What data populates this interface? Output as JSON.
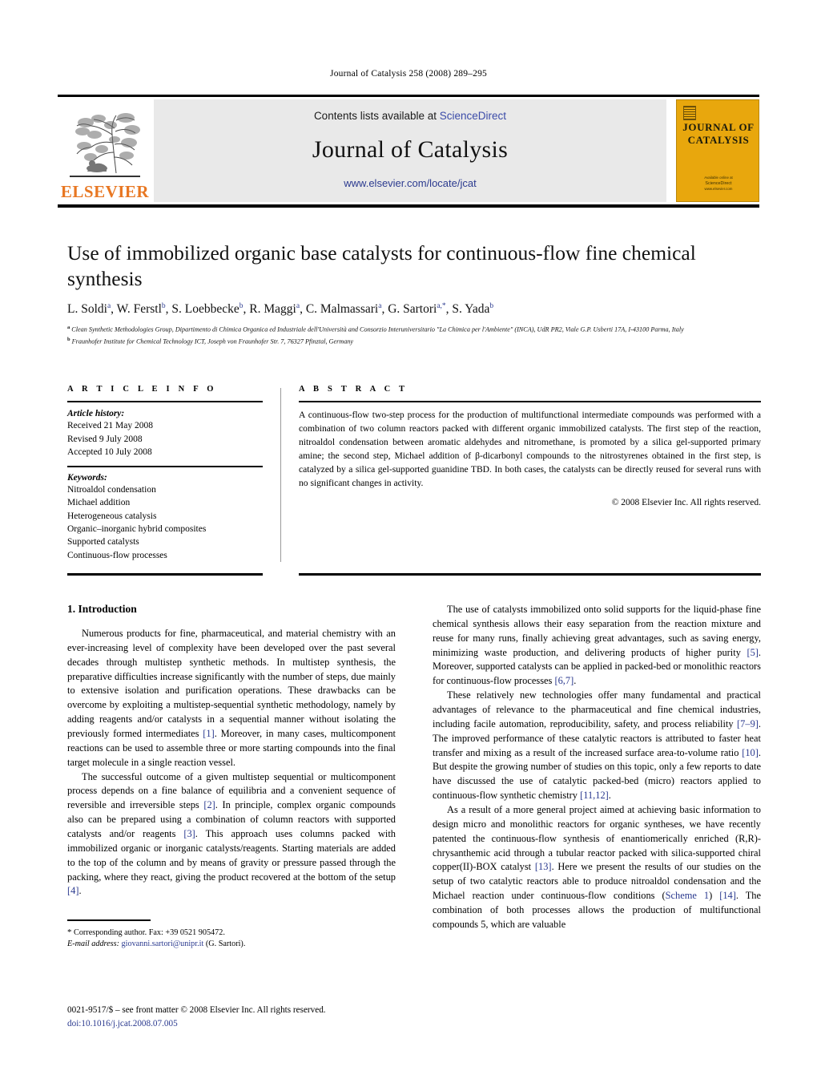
{
  "running_head": "Journal of Catalysis 258 (2008) 289–295",
  "masthead": {
    "publisher_logo_text": "ELSEVIER",
    "contents_prefix": "Contents lists available at ",
    "contents_link": "ScienceDirect",
    "journal_name": "Journal of Catalysis",
    "journal_url": "www.elsevier.com/locate/jcat",
    "cover_title_line1": "JOURNAL OF",
    "cover_title_line2": "CATALYSIS",
    "cover_foot_line1": "Available online at",
    "cover_foot_line2": "ScienceDirect",
    "cover_foot_line3": "www.elsevier.com"
  },
  "article": {
    "title": "Use of immobilized organic base catalysts for continuous-flow fine chemical synthesis",
    "authors": [
      {
        "name": "L. Soldi",
        "sup": "a"
      },
      {
        "name": "W. Ferstl",
        "sup": "b"
      },
      {
        "name": "S. Loebbecke",
        "sup": "b"
      },
      {
        "name": "R. Maggi",
        "sup": "a"
      },
      {
        "name": "C. Malmassari",
        "sup": "a"
      },
      {
        "name": "G. Sartori",
        "sup": "a,*"
      },
      {
        "name": "S. Yada",
        "sup": "b"
      }
    ],
    "affiliations": [
      {
        "marker": "a",
        "text": "Clean Synthetic Methodologies Group, Dipartimento di Chimica Organica ed Industriale dell'Università and Consorzio Interuniversitario \"La Chimica per l'Ambiente\" (INCA), UdR PR2, Viale G.P. Usberti 17A, I-43100 Parma, Italy"
      },
      {
        "marker": "b",
        "text": "Fraunhofer Institute for Chemical Technology ICT, Joseph von Fraunhofer Str. 7, 76327 Pfinztal, Germany"
      }
    ]
  },
  "article_info": {
    "label": "A R T I C L E   I N F O",
    "history_label": "Article history:",
    "history": [
      "Received 21 May 2008",
      "Revised 9 July 2008",
      "Accepted 10 July 2008"
    ],
    "keywords_label": "Keywords:",
    "keywords": [
      "Nitroaldol condensation",
      "Michael addition",
      "Heterogeneous catalysis",
      "Organic–inorganic hybrid composites",
      "Supported catalysts",
      "Continuous-flow processes"
    ]
  },
  "abstract": {
    "label": "A B S T R A C T",
    "text": "A continuous-flow two-step process for the production of multifunctional intermediate compounds was performed with a combination of two column reactors packed with different organic immobilized catalysts. The first step of the reaction, nitroaldol condensation between aromatic aldehydes and nitromethane, is promoted by a silica gel-supported primary amine; the second step, Michael addition of β-dicarbonyl compounds to the nitrostyrenes obtained in the first step, is catalyzed by a silica gel-supported guanidine TBD. In both cases, the catalysts can be directly reused for several runs with no significant changes in activity.",
    "copyright": "© 2008 Elsevier Inc. All rights reserved."
  },
  "body": {
    "section_title": "1. Introduction",
    "left_paragraphs": [
      "Numerous products for fine, pharmaceutical, and material chemistry with an ever-increasing level of complexity have been developed over the past several decades through multistep synthetic methods. In multistep synthesis, the preparative difficulties increase significantly with the number of steps, due mainly to extensive isolation and purification operations. These drawbacks can be overcome by exploiting a multistep-sequential synthetic methodology, namely by adding reagents and/or catalysts in a sequential manner without isolating the previously formed intermediates [1]. Moreover, in many cases, multicomponent reactions can be used to assemble three or more starting compounds into the final target molecule in a single reaction vessel.",
      "The successful outcome of a given multistep sequential or multicomponent process depends on a fine balance of equilibria and a convenient sequence of reversible and irreversible steps [2]. In principle, complex organic compounds also can be prepared using a combination of column reactors with supported catalysts and/or reagents [3]. This approach uses columns packed with immobilized organic or inorganic catalysts/reagents. Starting materials are added to the top of the column and by means of gravity or pressure passed through the packing, where they react, giving the product recovered at the bottom of the setup [4]."
    ],
    "right_paragraphs": [
      "The use of catalysts immobilized onto solid supports for the liquid-phase fine chemical synthesis allows their easy separation from the reaction mixture and reuse for many runs, finally achieving great advantages, such as saving energy, minimizing waste production, and delivering products of higher purity [5]. Moreover, supported catalysts can be applied in packed-bed or monolithic reactors for continuous-flow processes [6,7].",
      "These relatively new technologies offer many fundamental and practical advantages of relevance to the pharmaceutical and fine chemical industries, including facile automation, reproducibility, safety, and process reliability [7–9]. The improved performance of these catalytic reactors is attributed to faster heat transfer and mixing as a result of the increased surface area-to-volume ratio [10]. But despite the growing number of studies on this topic, only a few reports to date have discussed the use of catalytic packed-bed (micro) reactors applied to continuous-flow synthetic chemistry [11,12].",
      "As a result of a more general project aimed at achieving basic information to design micro and monolithic reactors for organic syntheses, we have recently patented the continuous-flow synthesis of enantiomerically enriched (R,R)-chrysanthemic acid through a tubular reactor packed with silica-supported chiral copper(II)-BOX catalyst [13]. Here we present the results of our studies on the setup of two catalytic reactors able to produce nitroaldol condensation and the Michael reaction under continuous-flow conditions (Scheme 1) [14]. The combination of both processes allows the production of multifunctional compounds 5, which are valuable"
    ]
  },
  "footnote": {
    "star": "*",
    "corresponding": "Corresponding author. Fax: +39 0521 905472.",
    "email_label": "E-mail address:",
    "email": "giovanni.sartori@unipr.it",
    "email_owner": "(G. Sartori)."
  },
  "page_footer": {
    "line1": "0021-9517/$ – see front matter © 2008 Elsevier Inc. All rights reserved.",
    "doi": "doi:10.1016/j.jcat.2008.07.005"
  },
  "colors": {
    "link_blue": "#2b3a8f",
    "sciencedirect_blue": "#3b4ba8",
    "elsevier_orange": "#E87722",
    "cover_gold": "#E8A70D"
  }
}
